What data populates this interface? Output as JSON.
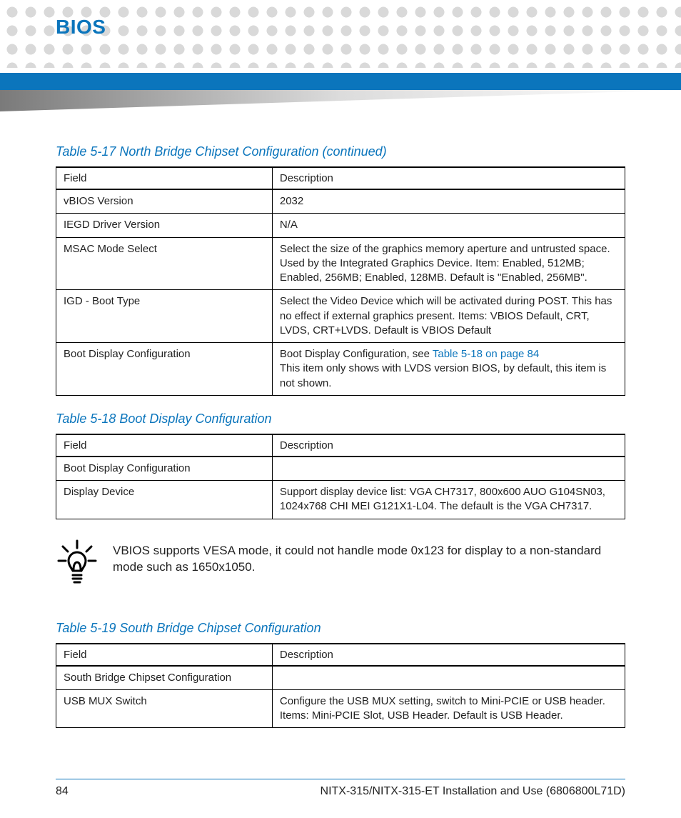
{
  "header": {
    "section": "BIOS"
  },
  "tables": {
    "t17": {
      "caption": "Table 5-17 North Bridge Chipset Configuration (continued)",
      "col_field": "Field",
      "col_desc": "Description",
      "rows": [
        {
          "field": "vBIOS Version",
          "desc": "2032"
        },
        {
          "field": "IEGD Driver Version",
          "desc": "N/A"
        },
        {
          "field": "MSAC Mode Select",
          "desc": "Select the size of the graphics memory aperture and untrusted space. Used by the Integrated Graphics Device. Item: Enabled, 512MB; Enabled, 256MB; Enabled, 128MB. Default is \"Enabled, 256MB\"."
        },
        {
          "field": "IGD - Boot Type",
          "desc": "Select the Video Device which will be activated during POST. This has no effect if external graphics present. Items: VBIOS Default, CRT, LVDS, CRT+LVDS. Default is VBIOS Default"
        },
        {
          "field": "Boot Display Configuration",
          "desc_pre": "Boot Display Configuration, see ",
          "link": "Table 5-18 on page 84",
          "desc_post": "This item only shows with LVDS version BIOS, by default, this item is not shown."
        }
      ]
    },
    "t18": {
      "caption": "Table 5-18 Boot Display Configuration",
      "col_field": "Field",
      "col_desc": "Description",
      "rows": [
        {
          "field": "Boot Display Configuration",
          "desc": ""
        },
        {
          "field": "Display Device",
          "desc": "Support display device list: VGA CH7317, 800x600 AUO G104SN03, 1024x768 CHI MEI G121X1-L04. The default is the VGA CH7317."
        }
      ]
    },
    "t19": {
      "caption": "Table 5-19 South Bridge Chipset Configuration",
      "col_field": "Field",
      "col_desc": "Description",
      "rows": [
        {
          "field": "South Bridge Chipset Configuration",
          "desc": ""
        },
        {
          "field": "USB MUX Switch",
          "desc": "Configure the USB MUX setting, switch to Mini-PCIE or USB header. Items: Mini-PCIE Slot, USB Header. Default is USB Header."
        }
      ]
    }
  },
  "note": {
    "text": "VBIOS supports VESA mode, it could not handle mode 0x123 for display to a non-standard mode such as 1650x1050."
  },
  "footer": {
    "page": "84",
    "doc": "NITX-315/NITX-315-ET Installation and Use (6806800L71D)"
  }
}
